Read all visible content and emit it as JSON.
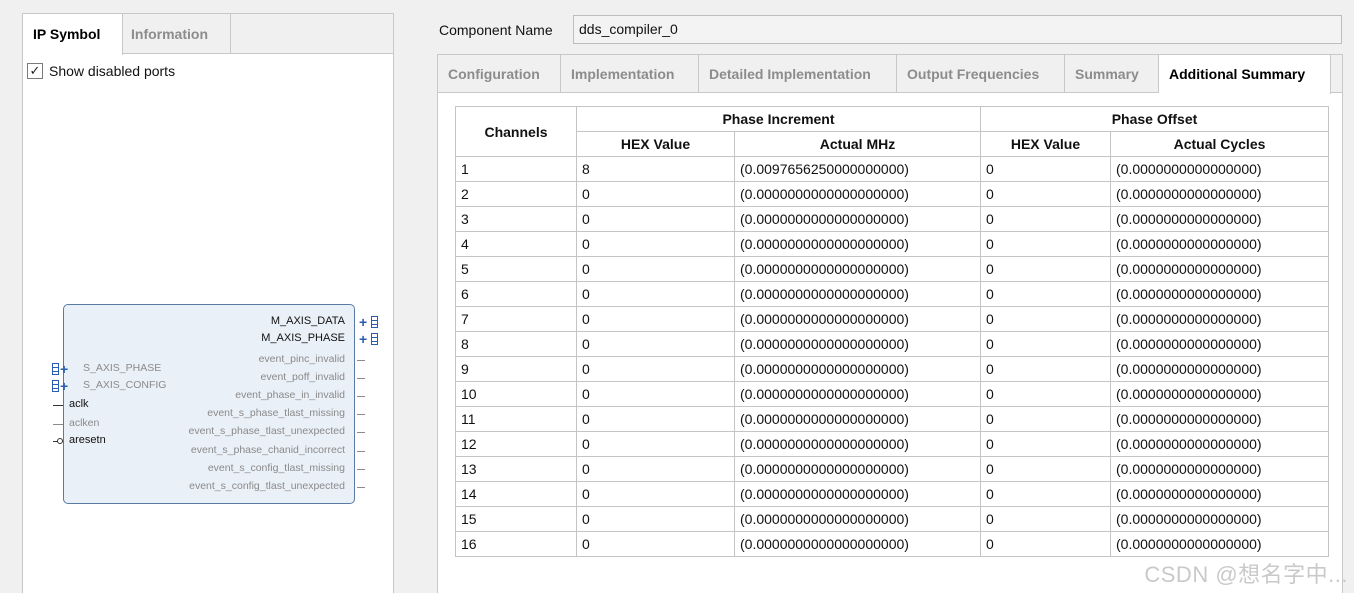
{
  "left_panel": {
    "tabs": [
      {
        "label": "IP Symbol"
      },
      {
        "label": "Information"
      }
    ],
    "show_disabled": {
      "label": "Show disabled ports",
      "checked": true
    },
    "ip_symbol": {
      "right_ports": [
        "M_AXIS_DATA",
        "M_AXIS_PHASE",
        "event_pinc_invalid",
        "event_poff_invalid",
        "event_phase_in_invalid",
        "event_s_phase_tlast_missing",
        "event_s_phase_tlast_unexpected",
        "event_s_phase_chanid_incorrect",
        "event_s_config_tlast_missing",
        "event_s_config_tlast_unexpected"
      ],
      "left_ports": [
        "S_AXIS_PHASE",
        "S_AXIS_CONFIG",
        "aclk",
        "aclken",
        "aresetn"
      ]
    }
  },
  "component": {
    "label": "Component Name",
    "value": "dds_compiler_0"
  },
  "right_tabs": [
    {
      "label": "Configuration"
    },
    {
      "label": "Implementation"
    },
    {
      "label": "Detailed Implementation"
    },
    {
      "label": "Output Frequencies"
    },
    {
      "label": "Summary"
    },
    {
      "label": "Additional Summary"
    }
  ],
  "table": {
    "col_channels": "Channels",
    "group_phase_increment": "Phase Increment",
    "group_phase_offset": "Phase Offset",
    "sub_hex": "HEX Value",
    "sub_actual_mhz": "Actual MHz",
    "sub_hex2": "HEX Value",
    "sub_actual_cycles": "Actual Cycles",
    "rows": [
      [
        "1",
        "8",
        "(0.0097656250000000000)",
        "0",
        "(0.0000000000000000)"
      ],
      [
        "2",
        "0",
        "(0.0000000000000000000)",
        "0",
        "(0.0000000000000000)"
      ],
      [
        "3",
        "0",
        "(0.0000000000000000000)",
        "0",
        "(0.0000000000000000)"
      ],
      [
        "4",
        "0",
        "(0.0000000000000000000)",
        "0",
        "(0.0000000000000000)"
      ],
      [
        "5",
        "0",
        "(0.0000000000000000000)",
        "0",
        "(0.0000000000000000)"
      ],
      [
        "6",
        "0",
        "(0.0000000000000000000)",
        "0",
        "(0.0000000000000000)"
      ],
      [
        "7",
        "0",
        "(0.0000000000000000000)",
        "0",
        "(0.0000000000000000)"
      ],
      [
        "8",
        "0",
        "(0.0000000000000000000)",
        "0",
        "(0.0000000000000000)"
      ],
      [
        "9",
        "0",
        "(0.0000000000000000000)",
        "0",
        "(0.0000000000000000)"
      ],
      [
        "10",
        "0",
        "(0.0000000000000000000)",
        "0",
        "(0.0000000000000000)"
      ],
      [
        "11",
        "0",
        "(0.0000000000000000000)",
        "0",
        "(0.0000000000000000)"
      ],
      [
        "12",
        "0",
        "(0.0000000000000000000)",
        "0",
        "(0.0000000000000000)"
      ],
      [
        "13",
        "0",
        "(0.0000000000000000000)",
        "0",
        "(0.0000000000000000)"
      ],
      [
        "14",
        "0",
        "(0.0000000000000000000)",
        "0",
        "(0.0000000000000000)"
      ],
      [
        "15",
        "0",
        "(0.0000000000000000000)",
        "0",
        "(0.0000000000000000)"
      ],
      [
        "16",
        "0",
        "(0.0000000000000000000)",
        "0",
        "(0.0000000000000000)"
      ]
    ]
  },
  "watermark": "CSDN @想名字中..."
}
